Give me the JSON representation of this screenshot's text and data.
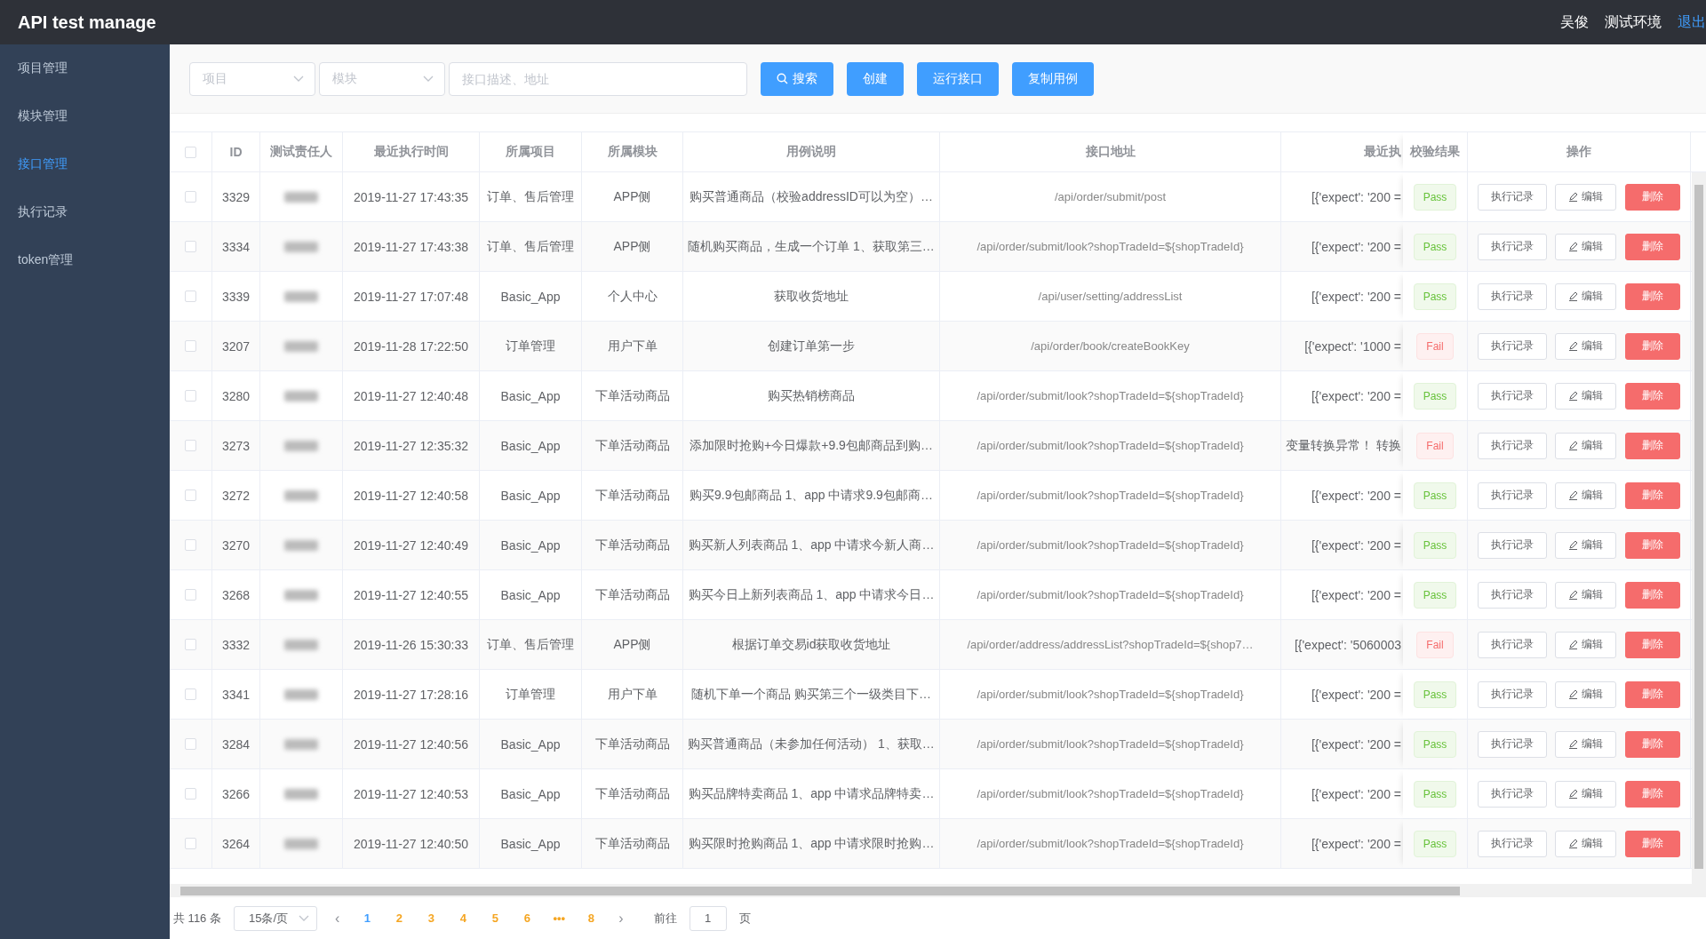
{
  "header": {
    "title": "API test manage",
    "user": "吴俊",
    "environment": "测试环境",
    "logout": "退出"
  },
  "sidebar": {
    "items": [
      {
        "label": "项目管理",
        "selected": false
      },
      {
        "label": "模块管理",
        "selected": false
      },
      {
        "label": "接口管理",
        "selected": true
      },
      {
        "label": "执行记录",
        "selected": false
      },
      {
        "label": "token管理",
        "selected": false
      }
    ]
  },
  "toolbar": {
    "project_select": {
      "placeholder": "项目"
    },
    "module_select": {
      "placeholder": "模块"
    },
    "search_field": {
      "placeholder": "接口描述、地址"
    },
    "buttons": [
      "搜索",
      "创建",
      "运行接口",
      "复制用例"
    ]
  },
  "table": {
    "header_checked": false,
    "columns": [
      "ID",
      "测试责任人",
      "最近执行时间",
      "所属项目",
      "所属模块",
      "用例说明",
      "接口地址",
      "最近执",
      "校验结果",
      "操作"
    ],
    "rows": [
      {
        "checked": false,
        "id": "3329",
        "time": "2019-11-27 17:43:35",
        "project": "订单、售后管理",
        "module": "APP侧",
        "description": "购买普通商品（校验addressID可以为空）…",
        "url": "/api/order/submit/post",
        "last_result": "[{'expect': '200 =",
        "passed": true,
        "status_label": "Pass",
        "actions": [
          "执行记录",
          "编辑",
          "删除"
        ]
      },
      {
        "checked": false,
        "id": "3334",
        "time": "2019-11-27 17:43:38",
        "project": "订单、售后管理",
        "module": "APP侧",
        "description": "随机购买商品，生成一个订单 1、获取第三…",
        "url": "/api/order/submit/look?shopTradeId=${shopTradeId}",
        "last_result": "[{'expect': '200 =",
        "passed": true,
        "status_label": "Pass",
        "actions": [
          "执行记录",
          "编辑",
          "删除"
        ]
      },
      {
        "checked": false,
        "id": "3339",
        "time": "2019-11-27 17:07:48",
        "project": "Basic_App",
        "module": "个人中心",
        "description": "获取收货地址",
        "url": "/api/user/setting/addressList",
        "last_result": "[{'expect': '200 =",
        "passed": true,
        "status_label": "Pass",
        "actions": [
          "执行记录",
          "编辑",
          "删除"
        ]
      },
      {
        "checked": false,
        "id": "3207",
        "time": "2019-11-28 17:22:50",
        "project": "订单管理",
        "module": "用户下单",
        "description": "创建订单第一步",
        "url": "/api/order/book/createBookKey",
        "last_result": "[{'expect': '1000 =",
        "passed": false,
        "status_label": "Fail",
        "actions": [
          "执行记录",
          "编辑",
          "删除"
        ]
      },
      {
        "checked": false,
        "id": "3280",
        "time": "2019-11-27 12:40:48",
        "project": "Basic_App",
        "module": "下单活动商品",
        "description": "购买热销榜商品",
        "url": "/api/order/submit/look?shopTradeId=${shopTradeId}",
        "last_result": "[{'expect': '200 =",
        "passed": true,
        "status_label": "Pass",
        "actions": [
          "执行记录",
          "编辑",
          "删除"
        ]
      },
      {
        "checked": false,
        "id": "3273",
        "time": "2019-11-27 12:35:32",
        "project": "Basic_App",
        "module": "下单活动商品",
        "description": "添加限时抢购+今日爆款+9.9包邮商品到购…",
        "url": "/api/order/submit/look?shopTradeId=${shopTradeId}",
        "last_result": "变量转换异常！ 转换",
        "passed": false,
        "status_label": "Fail",
        "actions": [
          "执行记录",
          "编辑",
          "删除"
        ]
      },
      {
        "checked": false,
        "id": "3272",
        "time": "2019-11-27 12:40:58",
        "project": "Basic_App",
        "module": "下单活动商品",
        "description": "购买9.9包邮商品 1、app 中请求9.9包邮商…",
        "url": "/api/order/submit/look?shopTradeId=${shopTradeId}",
        "last_result": "[{'expect': '200 =",
        "passed": true,
        "status_label": "Pass",
        "actions": [
          "执行记录",
          "编辑",
          "删除"
        ]
      },
      {
        "checked": false,
        "id": "3270",
        "time": "2019-11-27 12:40:49",
        "project": "Basic_App",
        "module": "下单活动商品",
        "description": "购买新人列表商品 1、app 中请求今新人商…",
        "url": "/api/order/submit/look?shopTradeId=${shopTradeId}",
        "last_result": "[{'expect': '200 =",
        "passed": true,
        "status_label": "Pass",
        "actions": [
          "执行记录",
          "编辑",
          "删除"
        ]
      },
      {
        "checked": false,
        "id": "3268",
        "time": "2019-11-27 12:40:55",
        "project": "Basic_App",
        "module": "下单活动商品",
        "description": "购买今日上新列表商品 1、app 中请求今日…",
        "url": "/api/order/submit/look?shopTradeId=${shopTradeId}",
        "last_result": "[{'expect': '200 =",
        "passed": true,
        "status_label": "Pass",
        "actions": [
          "执行记录",
          "编辑",
          "删除"
        ]
      },
      {
        "checked": false,
        "id": "3332",
        "time": "2019-11-26 15:30:33",
        "project": "订单、售后管理",
        "module": "APP侧",
        "description": "根据订单交易id获取收货地址",
        "url": "/api/order/address/addressList?shopTradeId=${shop7…",
        "last_result": "[{'expect': '5060003",
        "passed": false,
        "status_label": "Fail",
        "actions": [
          "执行记录",
          "编辑",
          "删除"
        ]
      },
      {
        "checked": false,
        "id": "3341",
        "time": "2019-11-27 17:28:16",
        "project": "订单管理",
        "module": "用户下单",
        "description": "随机下单一个商品 购买第三个一级类目下…",
        "url": "/api/order/submit/look?shopTradeId=${shopTradeId}",
        "last_result": "[{'expect': '200 =",
        "passed": true,
        "status_label": "Pass",
        "actions": [
          "执行记录",
          "编辑",
          "删除"
        ]
      },
      {
        "checked": false,
        "id": "3284",
        "time": "2019-11-27 12:40:56",
        "project": "Basic_App",
        "module": "下单活动商品",
        "description": "购买普通商品（未参加任何活动） 1、获取…",
        "url": "/api/order/submit/look?shopTradeId=${shopTradeId}",
        "last_result": "[{'expect': '200 =",
        "passed": true,
        "status_label": "Pass",
        "actions": [
          "执行记录",
          "编辑",
          "删除"
        ]
      },
      {
        "checked": false,
        "id": "3266",
        "time": "2019-11-27 12:40:53",
        "project": "Basic_App",
        "module": "下单活动商品",
        "description": "购买品牌特卖商品 1、app 中请求品牌特卖…",
        "url": "/api/order/submit/look?shopTradeId=${shopTradeId}",
        "last_result": "[{'expect': '200 =",
        "passed": true,
        "status_label": "Pass",
        "actions": [
          "执行记录",
          "编辑",
          "删除"
        ]
      },
      {
        "checked": false,
        "id": "3264",
        "time": "2019-11-27 12:40:50",
        "project": "Basic_App",
        "module": "下单活动商品",
        "description": "购买限时抢购商品 1、app 中请求限时抢购…",
        "url": "/api/order/submit/look?shopTradeId=${shopTradeId}",
        "last_result": "[{'expect': '200 =",
        "passed": true,
        "status_label": "Pass",
        "actions": [
          "执行记录",
          "编辑",
          "删除"
        ]
      }
    ]
  },
  "pagination": {
    "total": "共 116 条",
    "page_size": "15条/页",
    "prev": "‹",
    "pages": [
      {
        "label": "1",
        "selected": true
      },
      {
        "label": "2",
        "selected": false
      },
      {
        "label": "3",
        "selected": false
      },
      {
        "label": "4",
        "selected": false
      },
      {
        "label": "5",
        "selected": false
      },
      {
        "label": "6",
        "selected": false
      },
      {
        "label": "•••",
        "selected": false
      },
      {
        "label": "8",
        "selected": false
      }
    ],
    "next": "›",
    "goto_label": "前往",
    "goto_value": "1",
    "goto_unit": "页"
  }
}
